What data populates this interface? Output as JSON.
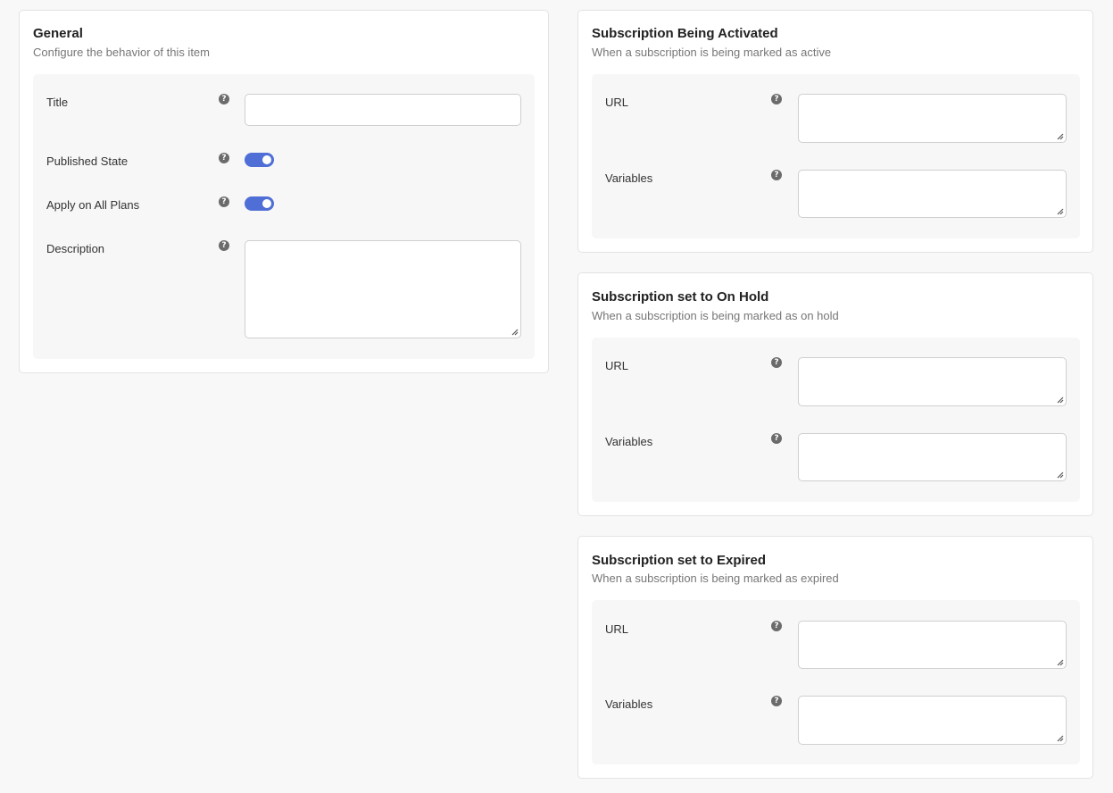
{
  "general": {
    "title": "General",
    "subtitle": "Configure the behavior of this item",
    "fields": {
      "title_label": "Title",
      "title_value": "",
      "published_label": "Published State",
      "published_on": true,
      "apply_label": "Apply on All Plans",
      "apply_on": true,
      "description_label": "Description",
      "description_value": ""
    }
  },
  "help_glyph": "?",
  "sections": [
    {
      "title": "Subscription Being Activated",
      "subtitle": "When a subscription is being marked as active",
      "url_label": "URL",
      "url_value": "",
      "variables_label": "Variables",
      "variables_value": ""
    },
    {
      "title": "Subscription set to On Hold",
      "subtitle": "When a subscription is being marked as on hold",
      "url_label": "URL",
      "url_value": "",
      "variables_label": "Variables",
      "variables_value": ""
    },
    {
      "title": "Subscription set to Expired",
      "subtitle": "When a subscription is being marked as expired",
      "url_label": "URL",
      "url_value": "",
      "variables_label": "Variables",
      "variables_value": ""
    }
  ]
}
